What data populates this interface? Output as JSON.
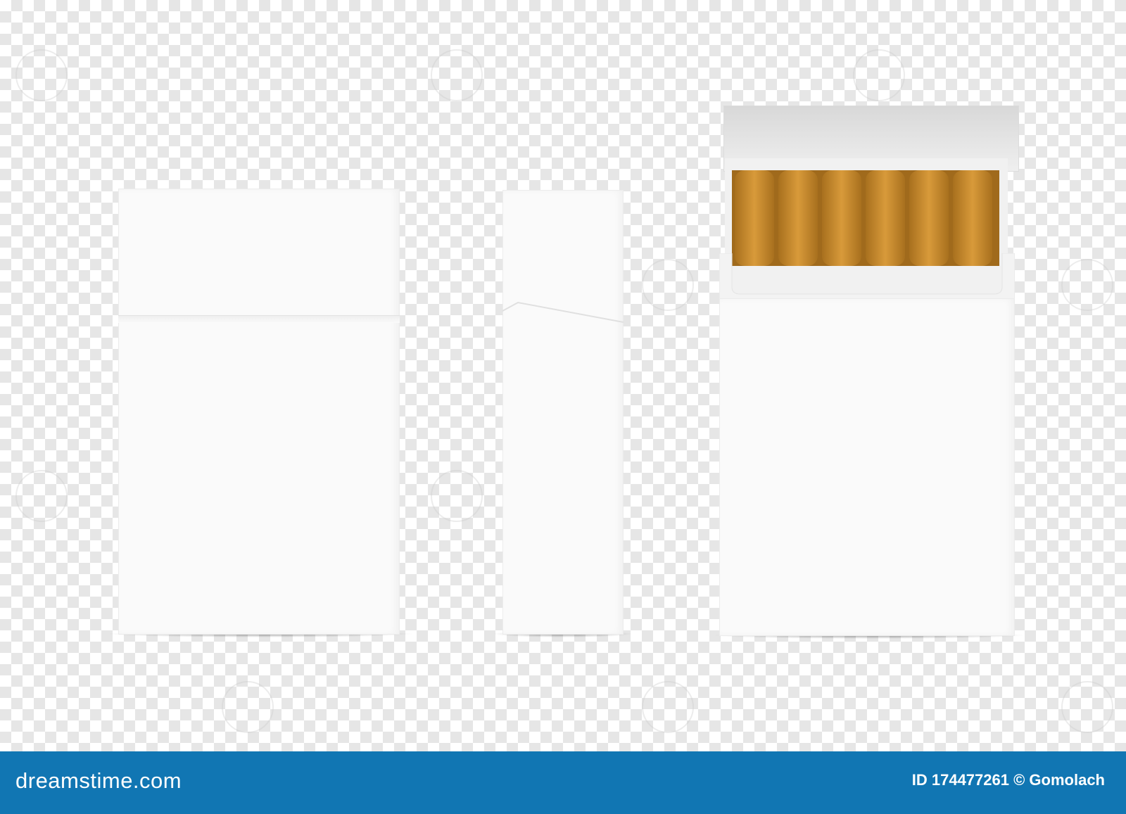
{
  "footer": {
    "logo_text": "dreamstime.com",
    "id_text": "ID 174477261 © Gomolach"
  },
  "colors": {
    "background_footer": "#1176b3",
    "pack_white": "#fafafa",
    "cigarette_filter": "#c88a2e"
  },
  "scene": {
    "items": [
      "closed-cigarette-pack-front",
      "closed-cigarette-pack-side",
      "open-cigarette-pack-with-cigarettes"
    ],
    "cigarette_count": 6
  }
}
